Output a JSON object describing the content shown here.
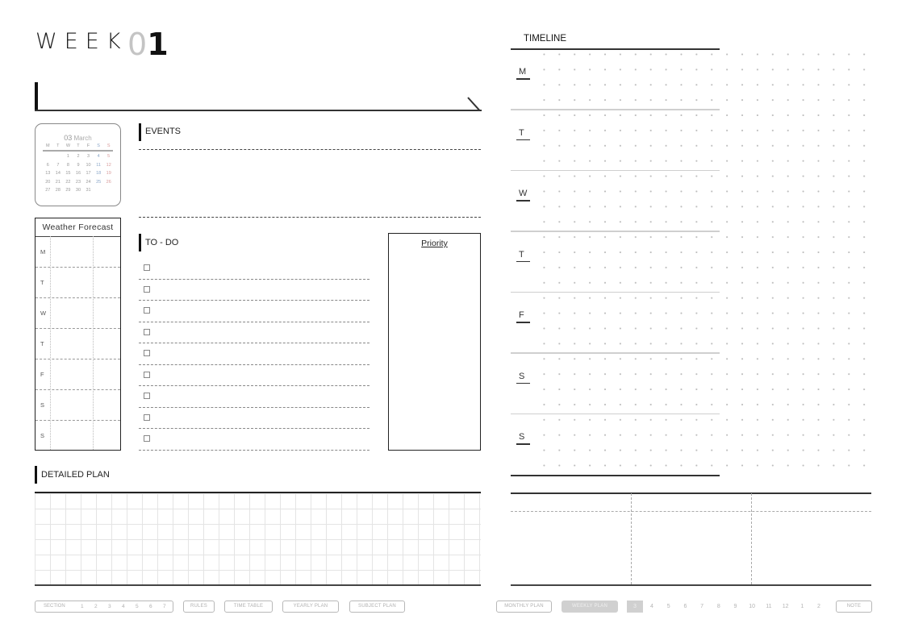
{
  "header": {
    "title": "WEEK",
    "week_number_prefix": "0",
    "week_number_suffix": "1"
  },
  "calendar": {
    "month_number": "03",
    "month_name": "March",
    "weekdays": [
      "M",
      "T",
      "W",
      "T",
      "F",
      "S",
      "S"
    ],
    "weeks": [
      [
        "",
        "",
        "1",
        "2",
        "3",
        "4",
        "5"
      ],
      [
        "6",
        "7",
        "8",
        "9",
        "10",
        "11",
        "12"
      ],
      [
        "13",
        "14",
        "15",
        "16",
        "17",
        "18",
        "19"
      ],
      [
        "20",
        "21",
        "22",
        "23",
        "24",
        "25",
        "26"
      ],
      [
        "27",
        "28",
        "29",
        "30",
        "31",
        "",
        ""
      ]
    ],
    "colors": {
      "saturday": "#8aa6c8",
      "sunday": "#d89a9a"
    }
  },
  "weather": {
    "title": "Weather Forecast",
    "days": [
      "M",
      "T",
      "W",
      "T",
      "F",
      "S",
      "S"
    ]
  },
  "events": {
    "label": "EVENTS"
  },
  "todo": {
    "label": "TO - DO",
    "item_count": 9
  },
  "priority": {
    "label": "Priority"
  },
  "detailed_plan": {
    "label": "DETAILED PLAN"
  },
  "timeline": {
    "label": "TIMELINE",
    "days": [
      "M",
      "T",
      "W",
      "T",
      "F",
      "S",
      "S"
    ]
  },
  "bottom_nav": {
    "section_label": "SECTION",
    "sections": [
      "1",
      "2",
      "3",
      "4",
      "5",
      "6",
      "7"
    ],
    "rules": "RULES",
    "time_table": "TIME TABLE",
    "yearly_plan": "YEARLY PLAN",
    "subject_plan": "SUBJECT PLAN",
    "monthly_plan": "MONTHLY PLAN",
    "weekly_plan": "WEEKLY PLAN",
    "months": [
      "3",
      "4",
      "5",
      "6",
      "7",
      "8",
      "9",
      "10",
      "11",
      "12",
      "1",
      "2"
    ],
    "active_month": "3",
    "note": "NOTE"
  }
}
